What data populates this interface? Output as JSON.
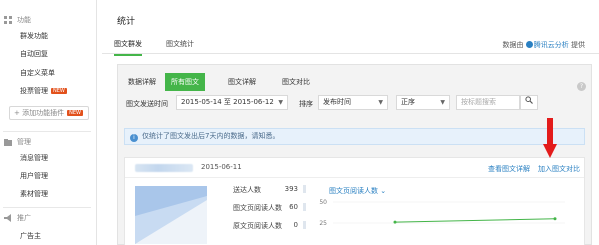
{
  "sidebar": {
    "features": {
      "title": "功能",
      "items": [
        {
          "label": "群发功能"
        },
        {
          "label": "自动回复"
        },
        {
          "label": "自定义菜单"
        },
        {
          "label": "投票管理",
          "badge": "NEW"
        }
      ],
      "add_plugin": "+ 添加功能插件",
      "add_plugin_badge": "NEW"
    },
    "management": {
      "title": "管理",
      "items": [
        {
          "label": "消息管理"
        },
        {
          "label": "用户管理"
        },
        {
          "label": "素材管理"
        }
      ]
    },
    "promotion": {
      "title": "推广",
      "items": [
        {
          "label": "广告主"
        }
      ]
    }
  },
  "main": {
    "title": "统计",
    "tabs": [
      {
        "label": "图文群发"
      },
      {
        "label": "图文统计"
      }
    ],
    "source": {
      "prefix": "数据由",
      "brand": "腾讯云分析",
      "suffix": "提供"
    }
  },
  "panel": {
    "sub_tabs": [
      {
        "label": "数据详解"
      },
      {
        "label": "所有图文"
      },
      {
        "label": "图文详解"
      },
      {
        "label": "图文对比"
      }
    ],
    "filters": {
      "time_label": "图文发送时间",
      "date_range": "2015-05-14 至 2015-06-12",
      "sort_label": "排序",
      "sort_value": "发布时间",
      "order_value": "正序",
      "search_placeholder": "按标题搜索"
    },
    "notice": "仅统计了图文发出后7天内的数据，请知悉。",
    "card": {
      "date": "2015-06-11",
      "link_detail": "查看图文详解",
      "link_compare": "加入图文对比",
      "stats": [
        {
          "label": "送达人数",
          "value": "393"
        },
        {
          "label": "图文页阅读人数",
          "value": "60"
        },
        {
          "label": "原文页阅读人数",
          "value": "0"
        }
      ],
      "chart_title": "图文页阅读人数 ⌄"
    }
  },
  "chart_data": {
    "type": "line",
    "title": "图文页阅读人数",
    "y_ticks": [
      "50",
      "25"
    ],
    "ylim": [
      0,
      50
    ],
    "series": [
      {
        "values": [
          26,
          30
        ]
      }
    ],
    "series_color": "#44b549"
  }
}
